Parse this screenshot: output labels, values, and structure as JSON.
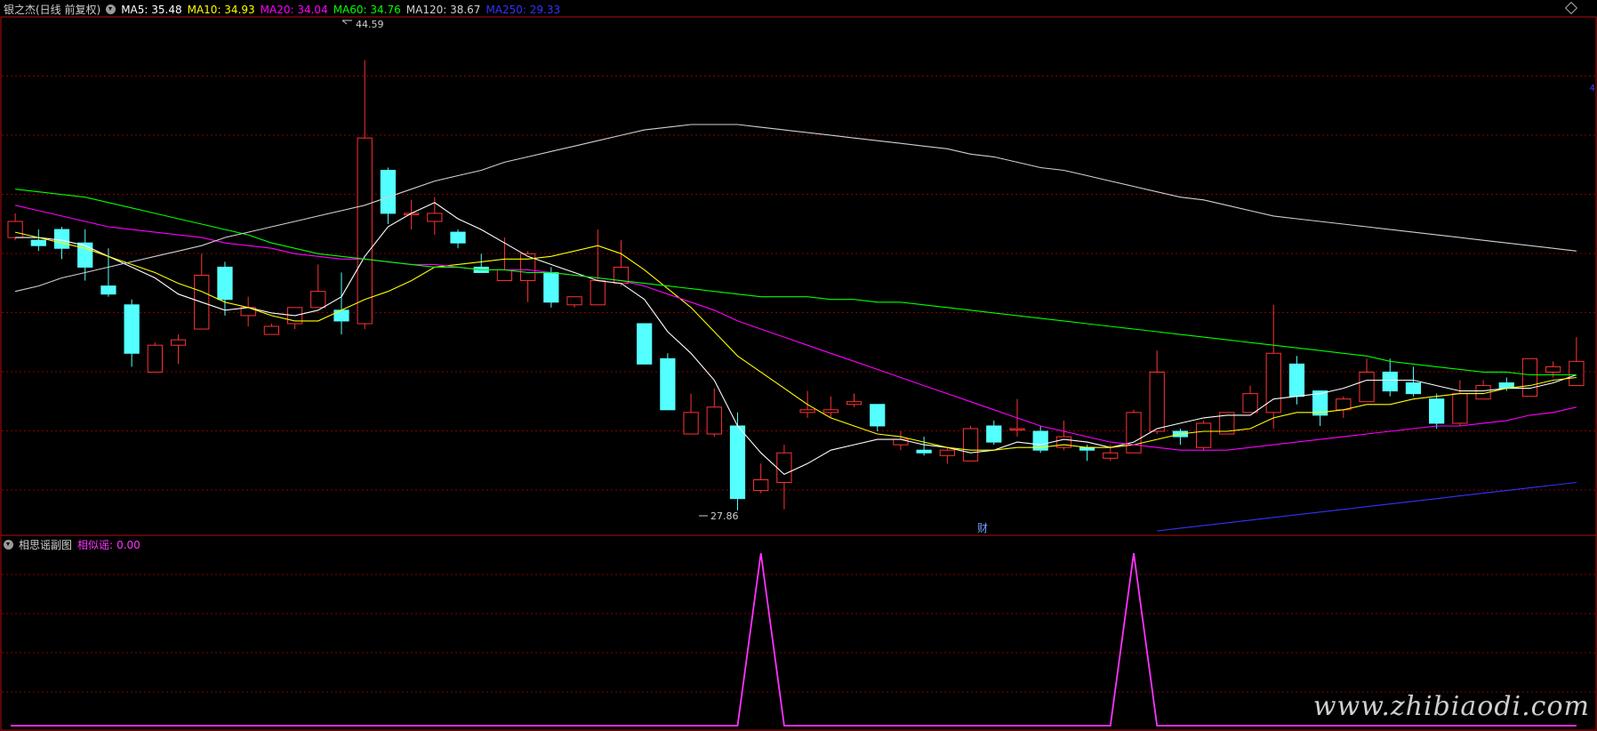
{
  "main": {
    "title": "银之杰(日线 前复权)",
    "ma": [
      {
        "label": "MA5:",
        "value": "35.48",
        "color": "#ffffff"
      },
      {
        "label": "MA10:",
        "value": "34.93",
        "color": "#ffff00"
      },
      {
        "label": "MA20:",
        "value": "34.04",
        "color": "#ff00ff"
      },
      {
        "label": "MA60:",
        "value": "34.76",
        "color": "#00ff00"
      },
      {
        "label": "MA120:",
        "value": "38.67",
        "color": "#d0d0d0"
      },
      {
        "label": "MA250:",
        "value": "29.33",
        "color": "#3333ff"
      }
    ],
    "high_label": "44.59",
    "low_label": "27.86",
    "finance_marker": "财",
    "right_edge": "4"
  },
  "sub": {
    "title": "相思谣副图",
    "indicator_label": "相似谣:",
    "indicator_value": "0.00",
    "indicator_color": "#ff33ff"
  },
  "watermark": "www.zhibiaodi.com",
  "colors": {
    "up": "#ff3333",
    "down": "#54ffff",
    "grid": "#8b0000",
    "border": "#b01010"
  },
  "chart_data": [
    {
      "type": "candlestick",
      "name": "main",
      "ylim": [
        27.0,
        46.2
      ],
      "candles": [
        [
          38.0,
          38.6,
          38.9,
          37.9
        ],
        [
          37.9,
          37.7,
          38.3,
          37.5
        ],
        [
          38.3,
          37.6,
          38.4,
          37.2
        ],
        [
          37.8,
          36.9,
          38.3,
          36.4
        ],
        [
          36.2,
          35.9,
          37.6,
          35.8
        ],
        [
          35.5,
          33.7,
          35.7,
          33.2
        ],
        [
          33.0,
          34.0,
          34.1,
          33.0
        ],
        [
          34.0,
          34.2,
          34.4,
          33.3
        ],
        [
          34.6,
          36.6,
          37.4,
          34.6
        ],
        [
          36.9,
          35.7,
          37.1,
          35.1
        ],
        [
          35.1,
          35.4,
          35.8,
          34.7
        ],
        [
          34.4,
          34.7,
          34.8,
          34.4
        ],
        [
          34.8,
          35.4,
          35.4,
          34.6
        ],
        [
          35.4,
          36.0,
          37.0,
          35.4
        ],
        [
          35.3,
          34.9,
          36.7,
          34.4
        ],
        [
          34.8,
          41.7,
          44.59,
          34.6
        ],
        [
          40.5,
          38.9,
          40.6,
          38.5
        ],
        [
          38.9,
          38.9,
          39.4,
          38.3
        ],
        [
          38.6,
          38.9,
          39.5,
          38.1
        ],
        [
          38.2,
          37.8,
          38.3,
          37.6
        ],
        [
          36.9,
          36.7,
          37.4,
          36.7
        ],
        [
          36.4,
          36.8,
          38.0,
          36.6
        ],
        [
          36.4,
          37.4,
          37.5,
          35.6
        ],
        [
          36.7,
          35.6,
          36.9,
          35.4
        ],
        [
          35.5,
          35.8,
          35.8,
          35.4
        ],
        [
          35.5,
          36.4,
          38.3,
          35.5
        ],
        [
          36.3,
          36.9,
          37.9,
          36.2
        ],
        [
          34.8,
          33.3,
          34.8,
          33.3
        ],
        [
          33.5,
          31.6,
          33.7,
          31.6
        ],
        [
          30.7,
          31.5,
          32.2,
          30.7
        ],
        [
          30.7,
          31.7,
          32.4,
          30.6
        ],
        [
          31.0,
          28.3,
          31.5,
          27.86
        ],
        [
          28.6,
          29.0,
          29.6,
          28.5
        ],
        [
          28.9,
          30.0,
          30.3,
          27.9
        ],
        [
          31.5,
          31.6,
          32.3,
          31.3
        ],
        [
          31.5,
          31.6,
          32.1,
          31.3
        ],
        [
          31.8,
          31.9,
          32.2,
          31.7
        ],
        [
          31.8,
          31.0,
          31.8,
          30.8
        ],
        [
          30.3,
          30.5,
          30.8,
          30.1
        ],
        [
          30.1,
          30.0,
          30.6,
          29.9
        ],
        [
          29.9,
          30.1,
          30.2,
          29.6
        ],
        [
          29.7,
          30.9,
          31.0,
          29.7
        ],
        [
          31.0,
          30.4,
          31.2,
          30.3
        ],
        [
          30.9,
          30.9,
          32.0,
          30.6
        ],
        [
          30.8,
          30.1,
          31.0,
          30.0
        ],
        [
          30.2,
          30.6,
          31.2,
          30.1
        ],
        [
          30.2,
          30.1,
          30.3,
          29.7
        ],
        [
          29.8,
          30.0,
          30.3,
          29.7
        ],
        [
          30.0,
          31.5,
          31.6,
          30.0
        ],
        [
          30.8,
          33.0,
          33.8,
          30.7
        ],
        [
          30.8,
          30.6,
          30.9,
          30.3
        ],
        [
          30.2,
          31.1,
          31.2,
          30.1
        ],
        [
          30.7,
          31.5,
          31.5,
          30.7
        ],
        [
          31.5,
          32.2,
          32.5,
          31.5
        ],
        [
          31.5,
          33.7,
          35.5,
          30.9
        ],
        [
          33.3,
          32.1,
          33.6,
          31.8
        ],
        [
          32.3,
          31.4,
          32.3,
          31.0
        ],
        [
          31.6,
          32.0,
          32.1,
          31.3
        ],
        [
          31.9,
          33.0,
          33.5,
          31.9
        ],
        [
          33.0,
          32.3,
          33.5,
          32.1
        ],
        [
          32.6,
          32.2,
          33.2,
          32.1
        ],
        [
          32.0,
          31.1,
          32.2,
          30.9
        ],
        [
          31.1,
          32.2,
          32.7,
          31.0
        ],
        [
          32.0,
          32.5,
          32.7,
          32.0
        ],
        [
          32.6,
          32.4,
          32.8,
          32.3
        ],
        [
          32.1,
          33.5,
          33.5,
          32.1
        ],
        [
          33.0,
          33.2,
          33.4,
          32.8
        ],
        [
          32.5,
          33.4,
          34.3,
          32.5
        ]
      ],
      "series": [
        {
          "name": "MA5",
          "color": "#ffffff",
          "values": [
            38.0,
            38.0,
            37.9,
            37.7,
            37.3,
            36.9,
            36.5,
            35.9,
            35.6,
            35.3,
            35.4,
            35.2,
            35.1,
            35.3,
            35.8,
            37.3,
            38.4,
            38.9,
            39.3,
            38.7,
            38.3,
            37.8,
            37.3,
            37.0,
            36.7,
            36.4,
            36.3,
            35.7,
            34.5,
            33.7,
            32.7,
            31.0,
            30.0,
            29.2,
            29.6,
            30.1,
            30.3,
            30.5,
            30.5,
            30.3,
            30.2,
            30.0,
            30.1,
            30.4,
            30.3,
            30.5,
            30.4,
            30.2,
            30.4,
            30.9,
            31.1,
            31.3,
            31.4,
            31.4,
            32.0,
            32.1,
            32.2,
            32.4,
            32.7,
            32.7,
            32.7,
            32.5,
            32.3,
            32.3,
            32.4,
            32.4,
            32.6,
            32.9
          ]
        },
        {
          "name": "MA10",
          "color": "#ffff00",
          "values": [
            38.2,
            38.0,
            37.8,
            37.6,
            37.3,
            37.0,
            36.7,
            36.3,
            36.0,
            35.6,
            35.4,
            35.1,
            34.9,
            34.9,
            35.3,
            35.7,
            36.0,
            36.4,
            36.9,
            37.0,
            37.1,
            37.2,
            37.2,
            37.3,
            37.5,
            37.7,
            37.4,
            36.8,
            36.1,
            35.4,
            34.5,
            33.6,
            33.0,
            32.4,
            31.8,
            31.3,
            31.0,
            30.7,
            30.6,
            30.4,
            30.2,
            30.1,
            30.1,
            30.2,
            30.2,
            30.3,
            30.2,
            30.2,
            30.3,
            30.5,
            30.7,
            30.8,
            30.8,
            30.9,
            31.3,
            31.5,
            31.5,
            31.6,
            31.8,
            31.8,
            32.0,
            32.1,
            32.2,
            32.2,
            32.4,
            32.5,
            32.7,
            32.8
          ]
        },
        {
          "name": "MA20",
          "color": "#ff00ff",
          "values": [
            39.2,
            39.0,
            38.8,
            38.6,
            38.4,
            38.3,
            38.2,
            38.1,
            38.0,
            37.8,
            37.7,
            37.6,
            37.4,
            37.3,
            37.2,
            37.2,
            37.1,
            37.0,
            37.0,
            36.9,
            36.8,
            36.8,
            36.8,
            36.7,
            36.6,
            36.5,
            36.4,
            36.2,
            35.9,
            35.6,
            35.3,
            34.9,
            34.6,
            34.3,
            34.0,
            33.7,
            33.4,
            33.1,
            32.8,
            32.5,
            32.2,
            31.9,
            31.6,
            31.3,
            31.0,
            30.8,
            30.6,
            30.4,
            30.3,
            30.2,
            30.1,
            30.1,
            30.1,
            30.2,
            30.3,
            30.4,
            30.5,
            30.6,
            30.7,
            30.8,
            30.9,
            31.0,
            31.0,
            31.1,
            31.2,
            31.4,
            31.5,
            31.7
          ]
        },
        {
          "name": "MA60",
          "color": "#00ff00",
          "values": [
            39.8,
            39.7,
            39.6,
            39.5,
            39.3,
            39.1,
            38.9,
            38.7,
            38.5,
            38.3,
            38.1,
            37.8,
            37.6,
            37.4,
            37.3,
            37.2,
            37.1,
            37.0,
            36.9,
            36.9,
            36.8,
            36.8,
            36.7,
            36.7,
            36.6,
            36.5,
            36.4,
            36.3,
            36.2,
            36.1,
            36.0,
            35.9,
            35.8,
            35.8,
            35.8,
            35.7,
            35.7,
            35.6,
            35.6,
            35.5,
            35.4,
            35.3,
            35.2,
            35.1,
            35.0,
            34.9,
            34.8,
            34.7,
            34.6,
            34.5,
            34.4,
            34.3,
            34.2,
            34.1,
            34.0,
            33.9,
            33.8,
            33.7,
            33.6,
            33.4,
            33.3,
            33.2,
            33.1,
            33.0,
            33.0,
            32.9,
            32.9,
            32.9
          ]
        },
        {
          "name": "MA120",
          "color": "#d0d0d0",
          "values": [
            36.0,
            36.2,
            36.5,
            36.7,
            36.9,
            37.1,
            37.3,
            37.5,
            37.7,
            38.0,
            38.2,
            38.4,
            38.6,
            38.8,
            39.0,
            39.2,
            39.5,
            39.8,
            40.1,
            40.3,
            40.5,
            40.8,
            41.0,
            41.2,
            41.4,
            41.6,
            41.8,
            42.0,
            42.1,
            42.2,
            42.2,
            42.2,
            42.1,
            42.0,
            41.9,
            41.8,
            41.7,
            41.6,
            41.5,
            41.4,
            41.3,
            41.1,
            41.0,
            40.8,
            40.6,
            40.5,
            40.3,
            40.1,
            39.9,
            39.7,
            39.5,
            39.4,
            39.2,
            39.0,
            38.8,
            38.7,
            38.6,
            38.5,
            38.4,
            38.3,
            38.2,
            38.1,
            38.0,
            37.9,
            37.8,
            37.7,
            37.6,
            37.5
          ]
        },
        {
          "name": "MA250",
          "color": "#3333ff",
          "values": [
            null,
            null,
            null,
            null,
            null,
            null,
            null,
            null,
            null,
            null,
            null,
            null,
            null,
            null,
            null,
            null,
            null,
            null,
            null,
            null,
            null,
            null,
            null,
            null,
            null,
            null,
            null,
            null,
            null,
            null,
            null,
            null,
            null,
            null,
            null,
            null,
            null,
            null,
            null,
            null,
            null,
            null,
            null,
            null,
            null,
            null,
            null,
            null,
            null,
            27.1,
            27.2,
            27.3,
            27.4,
            27.5,
            27.6,
            27.7,
            27.8,
            27.9,
            28.0,
            28.1,
            28.2,
            28.3,
            28.4,
            28.5,
            28.6,
            28.7,
            28.8,
            28.9
          ]
        }
      ]
    },
    {
      "type": "line",
      "name": "sub",
      "ylim": [
        0,
        1
      ],
      "series": [
        {
          "name": "相似谣",
          "color": "#ff33ff",
          "values": [
            0,
            0,
            0,
            0,
            0,
            0,
            0,
            0,
            0,
            0,
            0,
            0,
            0,
            0,
            0,
            0,
            0,
            0,
            0,
            0,
            0,
            0,
            0,
            0,
            0,
            0,
            0,
            0,
            0,
            0,
            0,
            0,
            1,
            0,
            0,
            0,
            0,
            0,
            0,
            0,
            0,
            0,
            0,
            0,
            0,
            0,
            0,
            0,
            1,
            0,
            0,
            0,
            0,
            0,
            0,
            0,
            0,
            0,
            0,
            0,
            0,
            0,
            0,
            0,
            0,
            0,
            0,
            0
          ]
        }
      ]
    }
  ]
}
